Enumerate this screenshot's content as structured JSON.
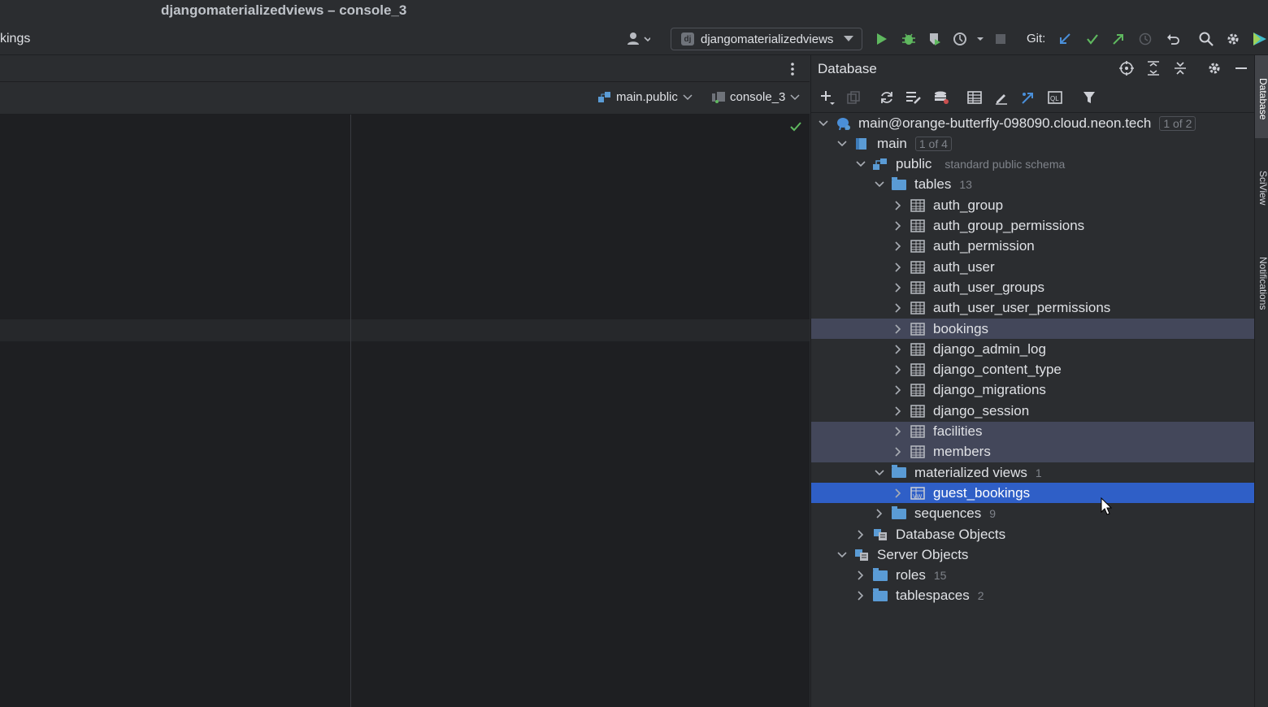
{
  "window": {
    "title": "djangomaterializedviews – console_3"
  },
  "toolbar": {
    "breadcrumb_fragment": "kings",
    "run_config": "djangomaterializedviews",
    "git_label": "Git:"
  },
  "editor": {
    "schema_selector": "main.public",
    "console_selector": "console_3"
  },
  "database": {
    "title": "Database",
    "tree": [
      {
        "label": "main@orange-butterfly-098090.cloud.neon.tech",
        "badge": "1 of 2",
        "level": 0,
        "expanded": true
      },
      {
        "label": "main",
        "badge": "1 of 4",
        "level": 1,
        "expanded": true
      },
      {
        "label": "public",
        "hint": "standard public schema",
        "level": 2,
        "expanded": true
      },
      {
        "label": "tables",
        "count": "13",
        "level": 3,
        "expanded": true
      },
      {
        "label": "auth_group",
        "level": 4
      },
      {
        "label": "auth_group_permissions",
        "level": 4
      },
      {
        "label": "auth_permission",
        "level": 4
      },
      {
        "label": "auth_user",
        "level": 4
      },
      {
        "label": "auth_user_groups",
        "level": 4
      },
      {
        "label": "auth_user_user_permissions",
        "level": 4
      },
      {
        "label": "bookings",
        "level": 4
      },
      {
        "label": "django_admin_log",
        "level": 4
      },
      {
        "label": "django_content_type",
        "level": 4
      },
      {
        "label": "django_migrations",
        "level": 4
      },
      {
        "label": "django_session",
        "level": 4
      },
      {
        "label": "facilities",
        "level": 4
      },
      {
        "label": "members",
        "level": 4
      },
      {
        "label": "materialized views",
        "count": "1",
        "level": 3,
        "expanded": true
      },
      {
        "label": "guest_bookings",
        "level": 4
      },
      {
        "label": "sequences",
        "count": "9",
        "level": 3
      },
      {
        "label": "Database Objects",
        "level": 2
      },
      {
        "label": "Server Objects",
        "level": 1,
        "expanded": true
      },
      {
        "label": "roles",
        "count": "15",
        "level": 2
      },
      {
        "label": "tablespaces",
        "count": "2",
        "level": 2
      }
    ]
  },
  "side_tabs": {
    "database": "Database",
    "sciview": "SciView",
    "notifications": "Notifications"
  },
  "colors": {
    "selection": "#2f5fc7",
    "soft_selection": "#43475a",
    "run_green": "#5fb85f",
    "git_blue": "#4a8fd9"
  }
}
